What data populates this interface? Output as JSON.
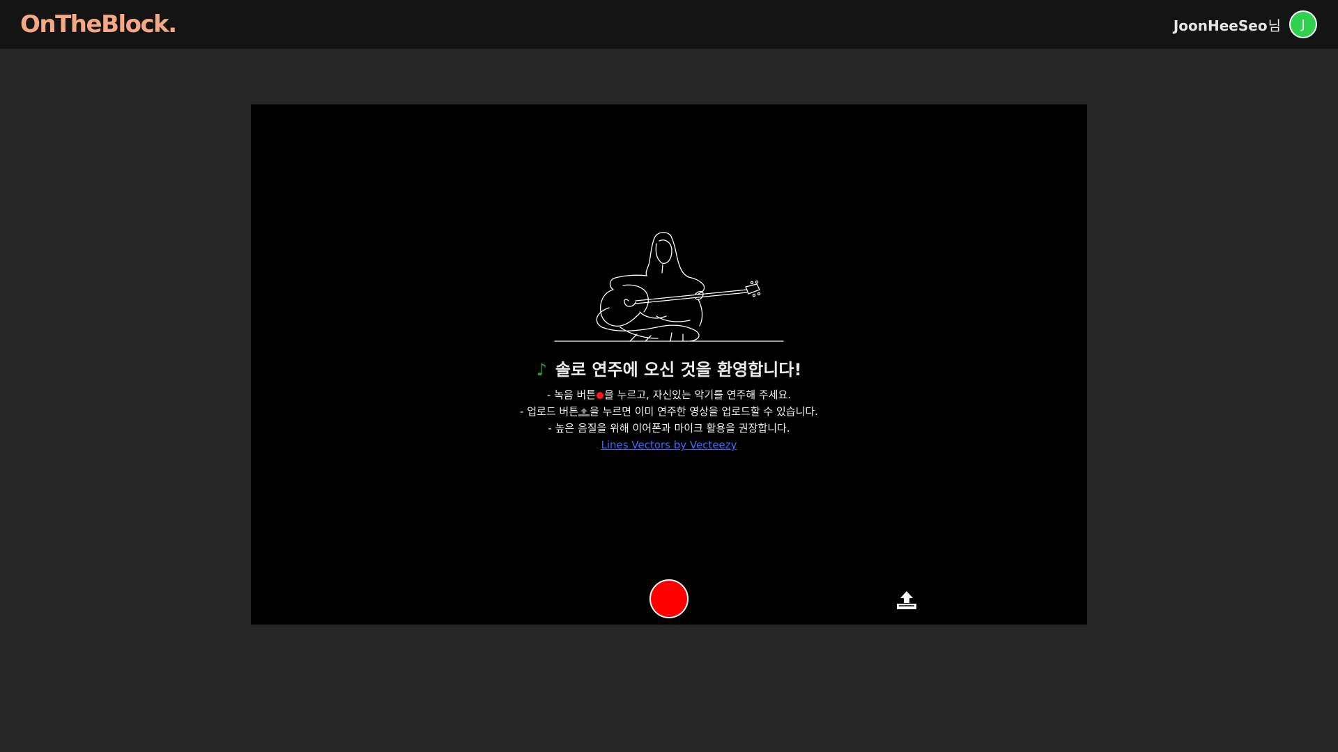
{
  "header": {
    "logo": "OnTheBlock.",
    "username": "JoonHeeSeo",
    "username_suffix": "님",
    "avatar_initial": "J"
  },
  "main": {
    "welcome_icon": "music-note-icon",
    "welcome_title": "솔로 연주에 오신 것을 환영합니다!",
    "instructions": {
      "line1_before": "- 녹음 버튼",
      "line1_after": "을 누르고, 자신있는 악기를 연주해 주세요.",
      "line2_before": "- 업로드 버튼",
      "line2_after": "을 누르면 이미 연주한 영상을 업로드할 수 있습니다.",
      "line3": "- 높은 음질을 위해 이어폰과 마이크 활용을 권장합니다."
    },
    "credit_link": "Lines Vectors by Vecteezy"
  },
  "controls": {
    "record_icon": "record-button",
    "upload_icon": "upload-icon"
  },
  "colors": {
    "logo": "#f4a883",
    "avatar": "#2fd14f",
    "record": "#ff0000",
    "link": "#3b6cff",
    "note": "#2ea02e",
    "stage": "#000000",
    "page": "#262626",
    "topbar": "#141414"
  }
}
